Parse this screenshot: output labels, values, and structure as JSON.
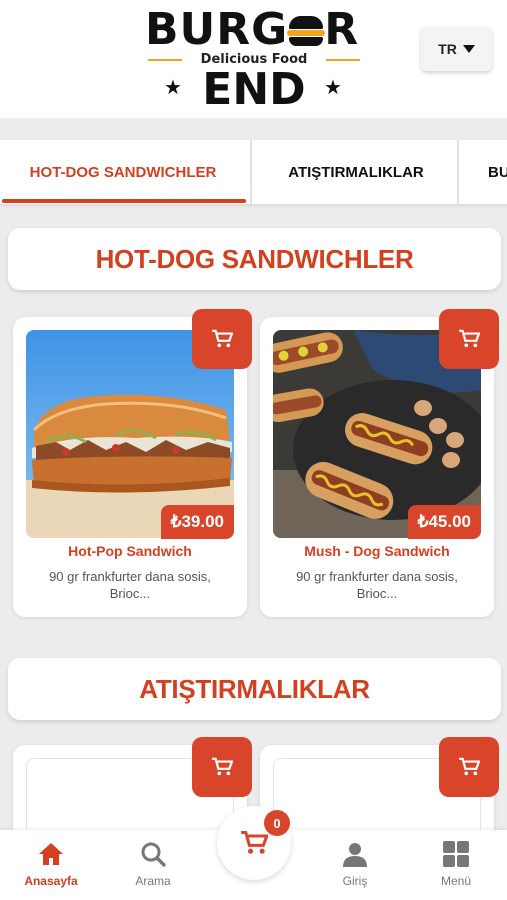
{
  "brand": {
    "logo_top": "BURGER",
    "logo_tagline": "Delicious Food",
    "logo_bottom": "END",
    "accent": "#d2401f",
    "logo_yellow": "#f0a51c"
  },
  "language": {
    "selected": "TR",
    "icon": "caret-down-icon"
  },
  "tabs": [
    {
      "label": "HOT-DOG SANDWICHLER",
      "active": true
    },
    {
      "label": "ATIŞTIRMALIKLAR",
      "active": false
    },
    {
      "label": "BU",
      "active": false
    }
  ],
  "sections": [
    {
      "title": "HOT-DOG SANDWICHLER",
      "products": [
        {
          "name": "Hot-Pop Sandwich",
          "price": "₺39.00",
          "description": "90 gr frankfurter dana sosis, Brioc...",
          "cart_icon": "cart-icon"
        },
        {
          "name": "Mush - Dog Sandwich",
          "price": "₺45.00",
          "description": "90 gr frankfurter dana sosis, Brioc...",
          "cart_icon": "cart-icon"
        }
      ]
    },
    {
      "title": "ATIŞTIRMALIKLAR",
      "products": [
        {
          "cart_icon": "cart-icon"
        },
        {
          "cart_icon": "cart-icon"
        }
      ]
    }
  ],
  "bottom_nav": {
    "items": [
      {
        "label": "Anasayfa",
        "icon": "home-icon",
        "active": true
      },
      {
        "label": "Arama",
        "icon": "search-icon",
        "active": false
      },
      {
        "label": "Giriş",
        "icon": "user-icon",
        "active": false
      },
      {
        "label": "Menü",
        "icon": "grid-icon",
        "active": false
      }
    ],
    "cart_count": "0"
  }
}
